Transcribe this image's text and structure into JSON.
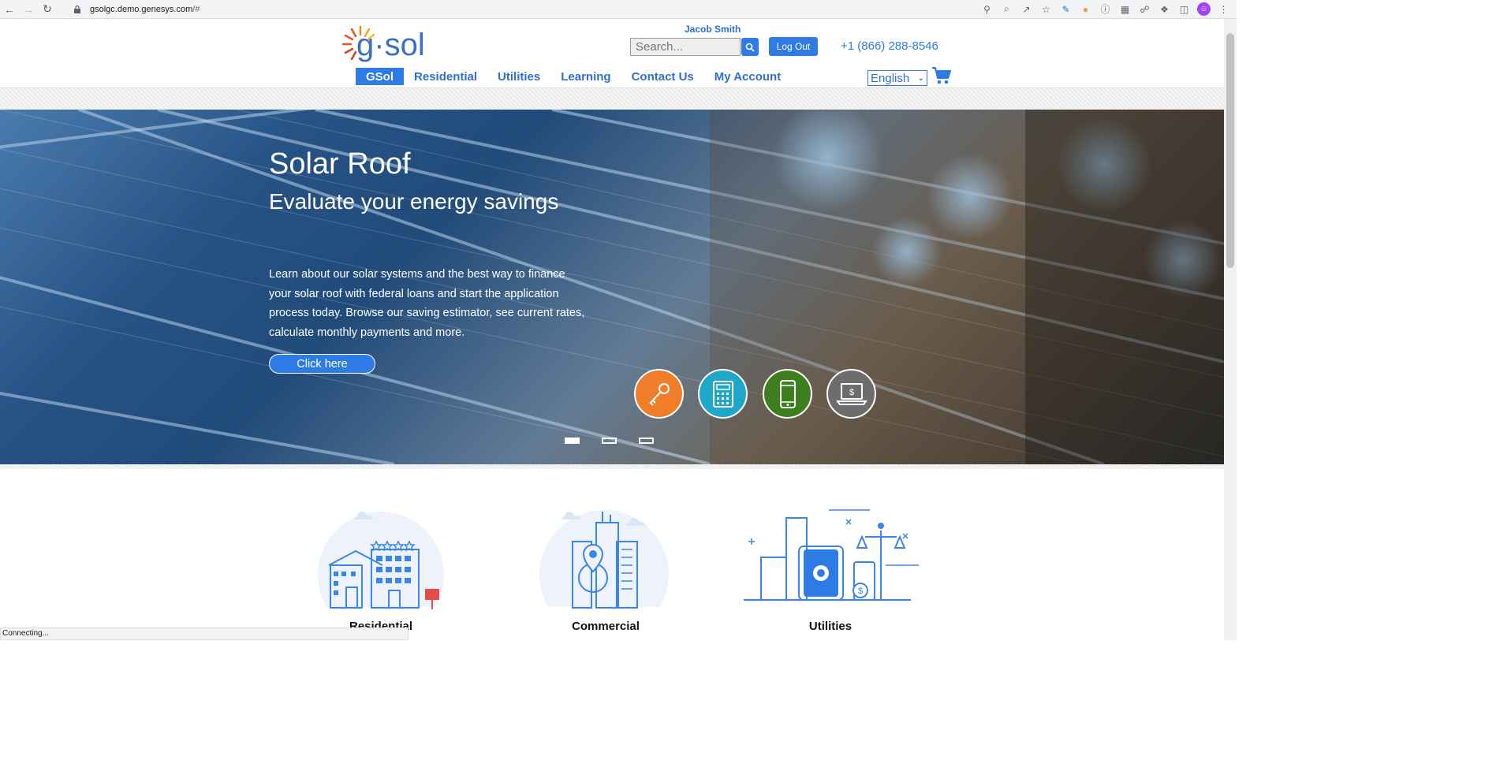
{
  "browser": {
    "url_host": "gsolgc.demo.genesys.com",
    "url_path": "/#",
    "status": "Connecting..."
  },
  "header": {
    "logo": "g·sol",
    "user_name": "Jacob Smith",
    "search_placeholder": "Search...",
    "logout_label": "Log Out",
    "phone": "+1 (866) 288-8546",
    "language": "English"
  },
  "nav": {
    "items": [
      {
        "label": "GSol",
        "active": true
      },
      {
        "label": "Residential"
      },
      {
        "label": "Utilities"
      },
      {
        "label": "Learning"
      },
      {
        "label": "Contact Us"
      },
      {
        "label": "My Account"
      }
    ]
  },
  "hero": {
    "title": "Solar Roof",
    "subtitle": "Evaluate your energy savings",
    "description": "Learn about our solar systems and the best way to finance your solar roof with federal loans and start the application process today. Browse our saving estimator, see current rates, calculate monthly payments and more.",
    "button_label": "Click here",
    "icons": [
      "key-icon",
      "calculator-icon",
      "mobile-phone-icon",
      "laptop-dollar-icon"
    ],
    "slide_count": 3,
    "active_slide": 1
  },
  "categories": [
    {
      "label": "Residential"
    },
    {
      "label": "Commercial"
    },
    {
      "label": "Utilities"
    }
  ],
  "colors": {
    "brand_blue": "#2e7be6",
    "brand_orange": "#f07d2a",
    "cyan": "#1ea7c9",
    "green": "#3d7f1e",
    "gray": "#6d6d6d"
  }
}
